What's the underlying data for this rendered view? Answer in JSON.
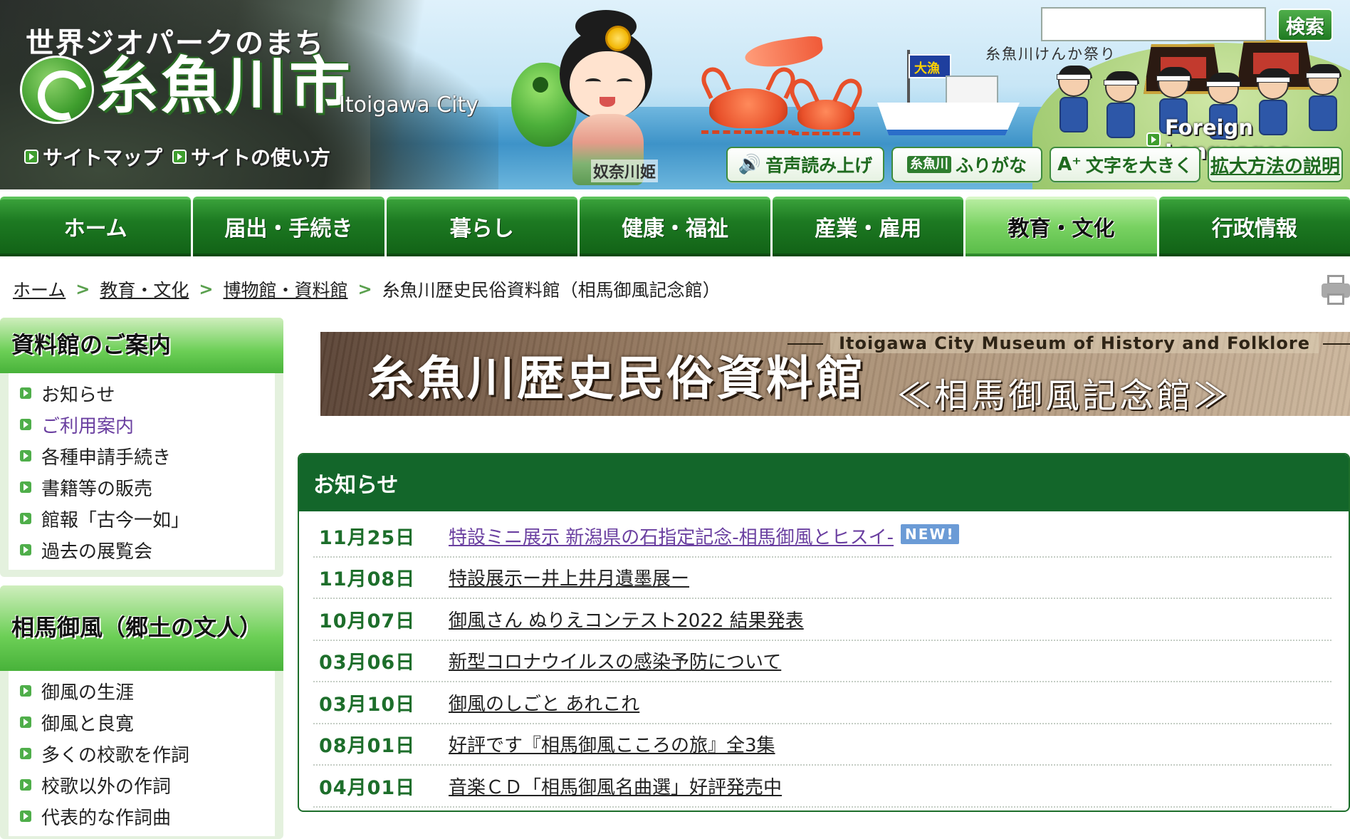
{
  "header": {
    "tagline": "世界ジオパークのまち",
    "city_name": "糸魚川市",
    "city_name_en": "Itoigawa City",
    "links": [
      "サイトマップ",
      "サイトの使い方"
    ],
    "mascot_name": "奴奈川姫",
    "ship_flag": "大漁",
    "festival_label": "糸魚川けんか祭り",
    "search": {
      "placeholder": "",
      "value": "",
      "button_label": "検索"
    },
    "foreign_languages": "Foreign Languages",
    "accessibility": [
      {
        "icon": "speaker-icon",
        "label": "音声読み上げ"
      },
      {
        "icon": "furigana-icon",
        "icon_text": "糸魚川",
        "label": "ふりがな"
      },
      {
        "icon": "text-size-icon",
        "label": "文字を大きく"
      }
    ],
    "explain_link": "拡大方法の説明"
  },
  "nav": {
    "items": [
      "ホーム",
      "届出・手続き",
      "暮らし",
      "健康・福祉",
      "産業・雇用",
      "教育・文化",
      "行政情報"
    ],
    "active_index": 5
  },
  "breadcrumb": {
    "items": [
      "ホーム",
      "教育・文化",
      "博物館・資料館"
    ],
    "separator": ">",
    "current": "糸魚川歴史民俗資料館（相馬御風記念館）"
  },
  "sidebar": {
    "sections": [
      {
        "title": "資料館のご案内",
        "items": [
          "お知らせ",
          "ご利用案内",
          "各種申請手続き",
          "書籍等の販売",
          "館報「古今一如」",
          "過去の展覧会"
        ],
        "visited_index": 1
      },
      {
        "title": "相馬御風（郷土の文人）",
        "items": [
          "御風の生涯",
          "御風と良寛",
          "多くの校歌を作詞",
          "校歌以外の作詞",
          "代表的な作詞曲"
        ]
      }
    ]
  },
  "banner": {
    "title_en": "Itoigawa City Museum of History and Folklore",
    "title_ja": "糸魚川歴史民俗資料館",
    "subtitle": "≪相馬御風記念館≫"
  },
  "news": {
    "heading": "お知らせ",
    "items": [
      {
        "date": "11月25日",
        "title": "特設ミニ展示 新潟県の石指定記念-相馬御風とヒスイ-",
        "new_badge": "NEW!",
        "visited": true
      },
      {
        "date": "11月08日",
        "title": "特設展示ー井上井月遺墨展ー"
      },
      {
        "date": "10月07日",
        "title": "御風さん ぬりえコンテスト2022 結果発表"
      },
      {
        "date": "03月06日",
        "title": "新型コロナウイルスの感染予防について"
      },
      {
        "date": "03月10日",
        "title": "御風のしごと あれこれ"
      },
      {
        "date": "08月01日",
        "title": "好評です『相馬御風こころの旅』全3集"
      },
      {
        "date": "04月01日",
        "title": "音楽ＣＤ「相馬御風名曲選」好評発売中"
      }
    ]
  },
  "colors": {
    "brand_green": "#13662a",
    "nav_green": "#1d7a22",
    "nav_active": "#79d262",
    "visited_link": "#6a3fa0",
    "sidebar_bg": "#e4f1de"
  }
}
